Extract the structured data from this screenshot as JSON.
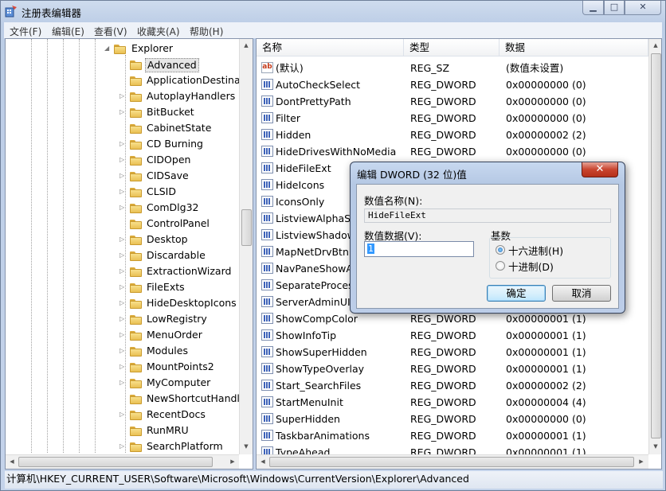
{
  "window": {
    "title": "注册表编辑器",
    "minimize_glyph": "▁",
    "maximize_glyph": "□",
    "close_glyph": "✕"
  },
  "menu": [
    {
      "label": "文件(F)"
    },
    {
      "label": "编辑(E)"
    },
    {
      "label": "查看(V)"
    },
    {
      "label": "收藏夹(A)"
    },
    {
      "label": "帮助(H)"
    }
  ],
  "tree": {
    "parent": {
      "label": "Explorer",
      "expander": "◢"
    },
    "selected": "Advanced",
    "items": [
      {
        "label": "Advanced",
        "has_children": false
      },
      {
        "label": "ApplicationDestinati",
        "has_children": false
      },
      {
        "label": "AutoplayHandlers",
        "has_children": true
      },
      {
        "label": "BitBucket",
        "has_children": true
      },
      {
        "label": "CabinetState",
        "has_children": false
      },
      {
        "label": "CD Burning",
        "has_children": true
      },
      {
        "label": "CIDOpen",
        "has_children": true
      },
      {
        "label": "CIDSave",
        "has_children": true
      },
      {
        "label": "CLSID",
        "has_children": true
      },
      {
        "label": "ComDlg32",
        "has_children": true
      },
      {
        "label": "ControlPanel",
        "has_children": false
      },
      {
        "label": "Desktop",
        "has_children": true
      },
      {
        "label": "Discardable",
        "has_children": true
      },
      {
        "label": "ExtractionWizard",
        "has_children": true
      },
      {
        "label": "FileExts",
        "has_children": true
      },
      {
        "label": "HideDesktopIcons",
        "has_children": true
      },
      {
        "label": "LowRegistry",
        "has_children": true
      },
      {
        "label": "MenuOrder",
        "has_children": true
      },
      {
        "label": "Modules",
        "has_children": true
      },
      {
        "label": "MountPoints2",
        "has_children": true
      },
      {
        "label": "MyComputer",
        "has_children": true
      },
      {
        "label": "NewShortcutHandle",
        "has_children": false
      },
      {
        "label": "RecentDocs",
        "has_children": true
      },
      {
        "label": "RunMRU",
        "has_children": false
      },
      {
        "label": "SearchPlatform",
        "has_children": true
      }
    ],
    "expander_glyph": "▷"
  },
  "list": {
    "columns": {
      "name": "名称",
      "type": "类型",
      "data": "数据"
    },
    "rows": [
      {
        "icon": "string-value-icon",
        "name": "(默认)",
        "type": "REG_SZ",
        "data": "(数值未设置)"
      },
      {
        "icon": "binary-value-icon",
        "name": "AutoCheckSelect",
        "type": "REG_DWORD",
        "data": "0x00000000 (0)"
      },
      {
        "icon": "binary-value-icon",
        "name": "DontPrettyPath",
        "type": "REG_DWORD",
        "data": "0x00000000 (0)"
      },
      {
        "icon": "binary-value-icon",
        "name": "Filter",
        "type": "REG_DWORD",
        "data": "0x00000000 (0)"
      },
      {
        "icon": "binary-value-icon",
        "name": "Hidden",
        "type": "REG_DWORD",
        "data": "0x00000002 (2)"
      },
      {
        "icon": "binary-value-icon",
        "name": "HideDrivesWithNoMedia",
        "type": "REG_DWORD",
        "data": "0x00000000 (0)"
      },
      {
        "icon": "binary-value-icon",
        "name": "HideFileExt",
        "type": "",
        "data": ""
      },
      {
        "icon": "binary-value-icon",
        "name": "HideIcons",
        "type": "",
        "data": ""
      },
      {
        "icon": "binary-value-icon",
        "name": "IconsOnly",
        "type": "",
        "data": ""
      },
      {
        "icon": "binary-value-icon",
        "name": "ListviewAlphaSel",
        "type": "",
        "data": ""
      },
      {
        "icon": "binary-value-icon",
        "name": "ListviewShadow",
        "type": "",
        "data": ""
      },
      {
        "icon": "binary-value-icon",
        "name": "MapNetDrvBtn",
        "type": "",
        "data": ""
      },
      {
        "icon": "binary-value-icon",
        "name": "NavPaneShowAl",
        "type": "",
        "data": ""
      },
      {
        "icon": "binary-value-icon",
        "name": "SeparateProcess",
        "type": "",
        "data": ""
      },
      {
        "icon": "binary-value-icon",
        "name": "ServerAdminUI",
        "type": "",
        "data": ""
      },
      {
        "icon": "binary-value-icon",
        "name": "ShowCompColor",
        "type": "REG_DWORD",
        "data": "0x00000001 (1)"
      },
      {
        "icon": "binary-value-icon",
        "name": "ShowInfoTip",
        "type": "REG_DWORD",
        "data": "0x00000001 (1)"
      },
      {
        "icon": "binary-value-icon",
        "name": "ShowSuperHidden",
        "type": "REG_DWORD",
        "data": "0x00000001 (1)"
      },
      {
        "icon": "binary-value-icon",
        "name": "ShowTypeOverlay",
        "type": "REG_DWORD",
        "data": "0x00000001 (1)"
      },
      {
        "icon": "binary-value-icon",
        "name": "Start_SearchFiles",
        "type": "REG_DWORD",
        "data": "0x00000002 (2)"
      },
      {
        "icon": "binary-value-icon",
        "name": "StartMenuInit",
        "type": "REG_DWORD",
        "data": "0x00000004 (4)"
      },
      {
        "icon": "binary-value-icon",
        "name": "SuperHidden",
        "type": "REG_DWORD",
        "data": "0x00000000 (0)"
      },
      {
        "icon": "binary-value-icon",
        "name": "TaskbarAnimations",
        "type": "REG_DWORD",
        "data": "0x00000001 (1)"
      },
      {
        "icon": "binary-value-icon",
        "name": "TypeAhead",
        "type": "REG_DWORD",
        "data": "0x00000001 (1)"
      }
    ]
  },
  "status_path": "计算机\\HKEY_CURRENT_USER\\Software\\Microsoft\\Windows\\CurrentVersion\\Explorer\\Advanced",
  "dialog": {
    "title": "编辑 DWORD (32 位)值",
    "close_glyph": "✕",
    "name_label": "数值名称(N):",
    "name_value": "HideFileExt",
    "data_label": "数值数据(V):",
    "data_value": "1",
    "base_label": "基数",
    "hex_label": "十六进制(H)",
    "dec_label": "十进制(D)",
    "base_selected": "hex",
    "ok_label": "确定",
    "cancel_label": "取消"
  },
  "scroll": {
    "up": "▲",
    "down": "▼",
    "left": "◀",
    "right": "▶",
    "grip": "≡"
  }
}
